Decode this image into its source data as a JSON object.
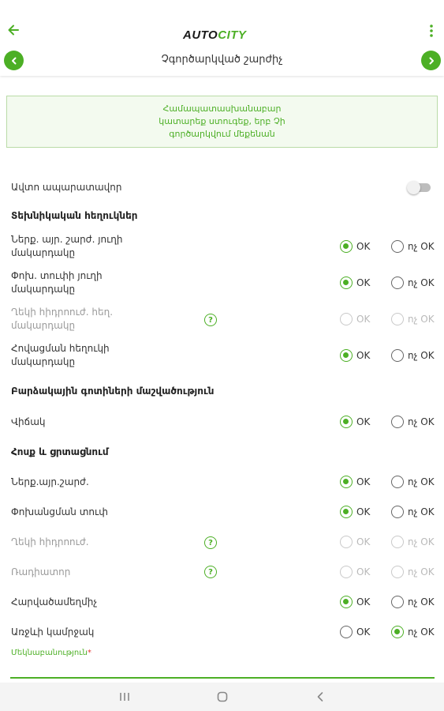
{
  "header": {
    "logo_part1": "AUTO",
    "logo_part2": "CITY",
    "title": "Չգործարկված շարժիչ"
  },
  "notice": "Համապատասխանաբար կատարեք ստուգեք, երբ Չի գործարկվում մեքենան",
  "auto_transmission": {
    "label": "Ավտո ապարատավոր",
    "enabled": false
  },
  "options": {
    "ok": "OK",
    "notok": "ոչ OK"
  },
  "sections": {
    "tech_fluids": "Տեխնիկական հեղուկներ",
    "tire_tread": "Բարձակային գոտիների մաշվածություն",
    "air_seal": "Հոսք և ցրտացնում"
  },
  "rows": [
    {
      "label": "Ներք. այր. շարժ. յուղի մակարդակը",
      "selected": "ok",
      "disabled": false,
      "help": false
    },
    {
      "label": "Փոխ. տուփի յուղի մակարդակը",
      "selected": "ok",
      "disabled": false,
      "help": false
    },
    {
      "label": "Ղեկի հիդրոուժ. հեղ. մակարդակը",
      "selected": null,
      "disabled": true,
      "help": true
    },
    {
      "label": "Հովացման հեղուկի մակարդակը",
      "selected": "ok",
      "disabled": false,
      "help": false
    },
    {
      "label": "Վիճակ",
      "selected": "ok",
      "disabled": false,
      "help": false
    },
    {
      "label": "Ներք.այր.շարժ.",
      "selected": "ok",
      "disabled": false,
      "help": false
    },
    {
      "label": "Փոխանցման տուփ",
      "selected": "ok",
      "disabled": false,
      "help": false
    },
    {
      "label": "Ղեկի հիդրոուժ.",
      "selected": null,
      "disabled": true,
      "help": true
    },
    {
      "label": "Ռադիատոր",
      "selected": null,
      "disabled": true,
      "help": true
    },
    {
      "label": "Հարվածամեղմիչ",
      "selected": "ok",
      "disabled": false,
      "help": false
    },
    {
      "label": "Առջևի կամրջակ",
      "selected": "notok",
      "disabled": false,
      "help": false
    }
  ],
  "comment_label": "Մեկնաբանություն",
  "comment_required_mark": "*",
  "colors": {
    "accent": "#4caf25",
    "required": "#e53935"
  }
}
